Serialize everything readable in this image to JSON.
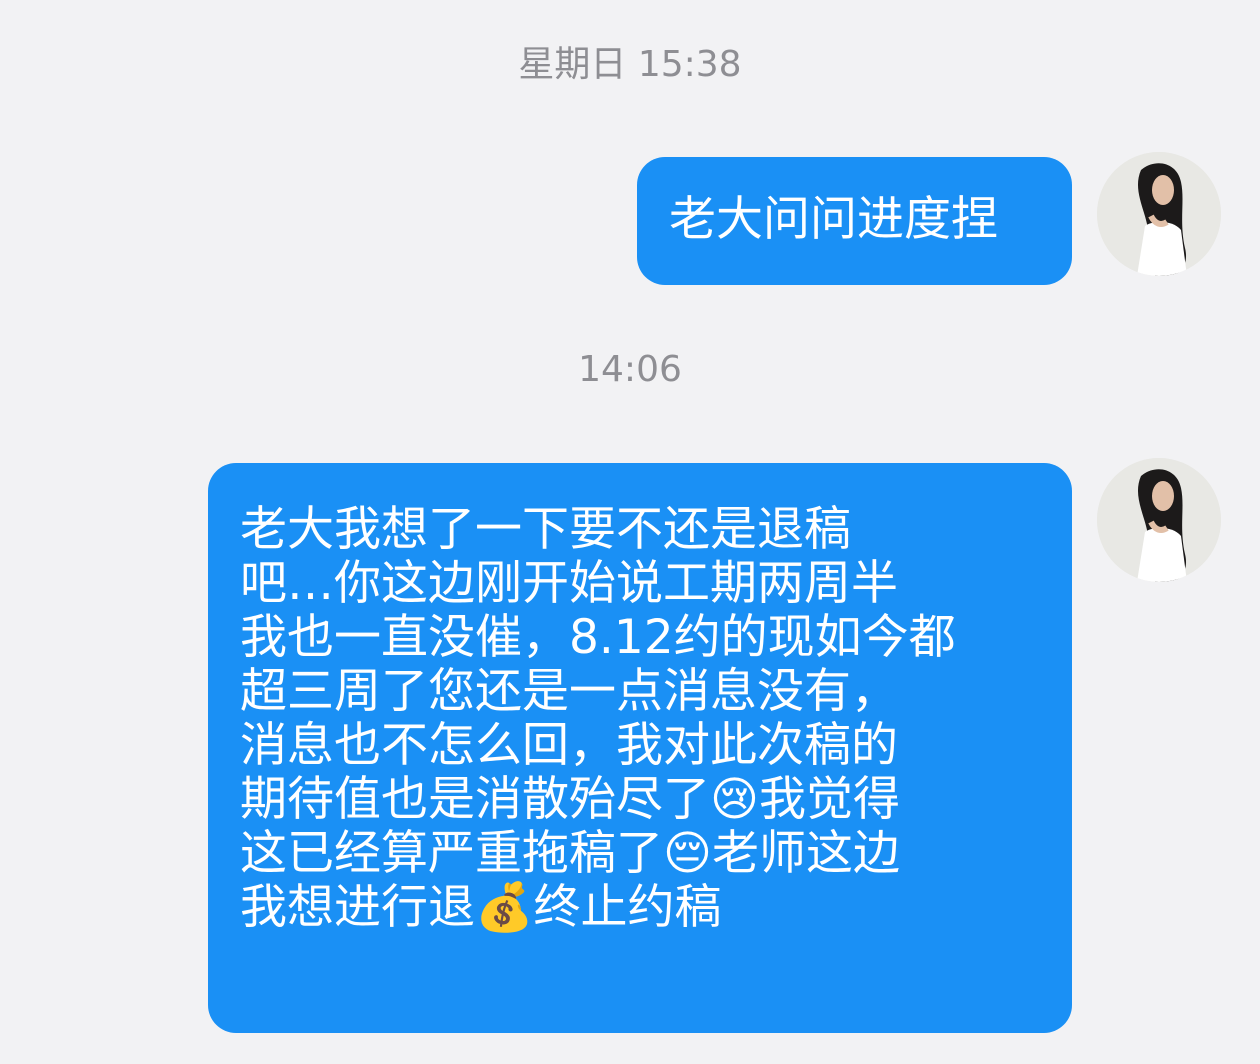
{
  "chat": {
    "messages": [
      {
        "time": "星期日 15:38",
        "text": "老大问问进度捏",
        "sender": "me"
      },
      {
        "time": "14:06",
        "text": "老大我想了一下要不还是退稿\n吧…你这边刚开始说工期两周半\n我也一直没催，8.12约的现如今都\n超三周了您还是一点消息没有，\n消息也不怎么回，我对此次稿的\n期待值也是消散殆尽了😢我觉得\n这已经算严重拖稿了😔老师这边\n我想进行退💰终止约稿",
        "sender": "me"
      }
    ],
    "avatar_icon": "user-avatar-photo"
  },
  "colors": {
    "background": "#f2f2f4",
    "bubble": "#1a90f5",
    "bubble_text": "#ffffff",
    "timestamp_text": "#8e8e93"
  }
}
